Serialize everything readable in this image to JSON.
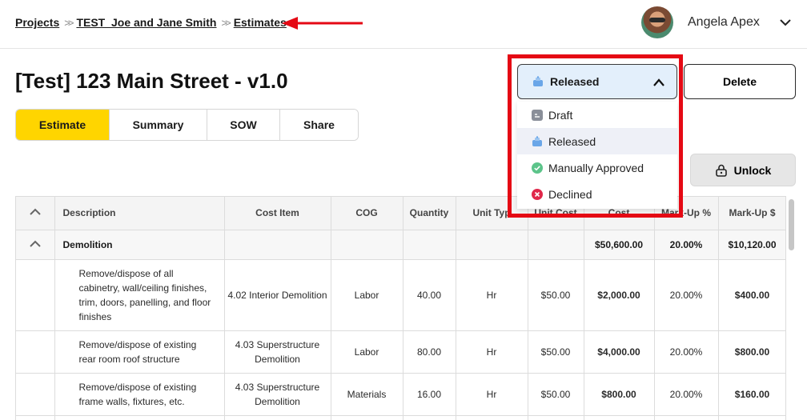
{
  "breadcrumbs": [
    "Projects",
    "TEST_Joe and Jane Smith",
    "Estimates"
  ],
  "user": {
    "name": "Angela Apex"
  },
  "page": {
    "title": "[Test] 123 Main Street - v1.0"
  },
  "tabs": [
    {
      "label": "Estimate",
      "active": true
    },
    {
      "label": "Summary",
      "active": false
    },
    {
      "label": "SOW",
      "active": false
    },
    {
      "label": "Share",
      "active": false
    }
  ],
  "status": {
    "selected": "Released",
    "options": [
      {
        "label": "Draft",
        "icon": "draft-icon",
        "color": "#8a8f99"
      },
      {
        "label": "Released",
        "icon": "released-icon",
        "color": "#6aa6e8"
      },
      {
        "label": "Manually Approved",
        "icon": "check-circle-icon",
        "color": "#5cc48a"
      },
      {
        "label": "Declined",
        "icon": "x-circle-icon",
        "color": "#e0284a"
      }
    ]
  },
  "buttons": {
    "delete": "Delete",
    "unlock": "Unlock"
  },
  "table": {
    "headers": [
      "Description",
      "Cost Item",
      "COG",
      "Quantity",
      "Unit Typ",
      "Unit Cost",
      "Cost",
      "Mark-Up %",
      "Mark-Up $"
    ],
    "group": {
      "name": "Demolition",
      "cost": "$50,600.00",
      "markup_pct": "20.00%",
      "markup_amt": "$10,120.00"
    },
    "rows": [
      {
        "description": "Remove/dispose of all cabinetry, wall/ceiling finishes, trim, doors, panelling, and floor finishes",
        "cost_item": "4.02 Interior Demolition",
        "cog": "Labor",
        "quantity": "40.00",
        "unit": "Hr",
        "unit_cost": "$50.00",
        "cost": "$2,000.00",
        "markup_pct": "20.00%",
        "markup_amt": "$400.00"
      },
      {
        "description": "Remove/dispose of existing rear room roof structure",
        "cost_item": "4.03 Superstructure Demolition",
        "cog": "Labor",
        "quantity": "80.00",
        "unit": "Hr",
        "unit_cost": "$50.00",
        "cost": "$4,000.00",
        "markup_pct": "20.00%",
        "markup_amt": "$800.00"
      },
      {
        "description": "Remove/dispose of existing frame walls, fixtures, etc.",
        "cost_item": "4.03 Superstructure Demolition",
        "cog": "Materials",
        "quantity": "16.00",
        "unit": "Hr",
        "unit_cost": "$50.00",
        "cost": "$800.00",
        "markup_pct": "20.00%",
        "markup_amt": "$160.00"
      }
    ]
  },
  "colors": {
    "accent_tab": "#ffd500",
    "annotation_red": "#e50914",
    "select_bg": "#e3effb"
  }
}
